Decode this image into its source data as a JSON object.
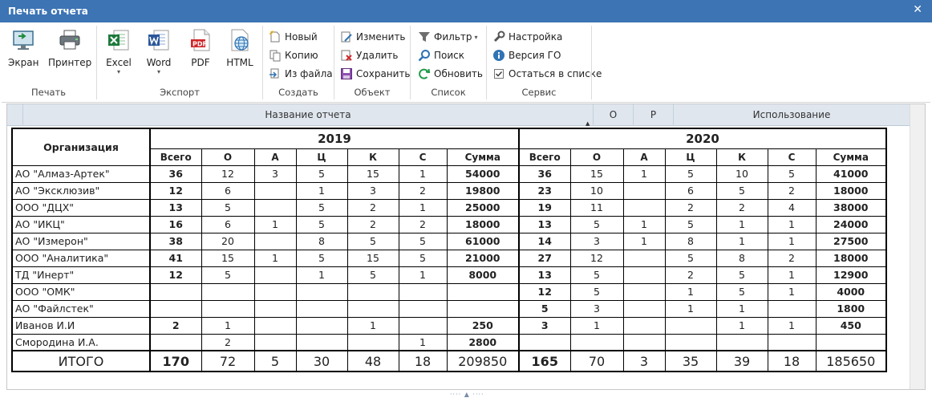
{
  "window": {
    "title": "Печать отчета",
    "close": "✕"
  },
  "ribbon": {
    "print": {
      "caption": "Печать",
      "screen": "Экран",
      "printer": "Принтер"
    },
    "export": {
      "caption": "Экспорт",
      "excel": "Excel",
      "word": "Word",
      "pdf": "PDF",
      "html": "HTML",
      "dropdown": "▾"
    },
    "create": {
      "caption": "Создать",
      "new": "Новый",
      "copy": "Копию",
      "from_file": "Из файла"
    },
    "object": {
      "caption": "Объект",
      "edit": "Изменить",
      "delete": "Удалить",
      "save": "Сохранить"
    },
    "list": {
      "caption": "Список",
      "filter": "Фильтр",
      "filter_dd": "▾",
      "search": "Поиск",
      "refresh": "Обновить"
    },
    "service": {
      "caption": "Сервис",
      "settings": "Настройка",
      "version": "Версия ГО",
      "stay_in_list": "Остаться в списке",
      "stay_checked": true
    }
  },
  "grid_header": {
    "name": "Название отчета",
    "o": "О",
    "r": "Р",
    "usage": "Использование",
    "sort": "▲"
  },
  "report": {
    "org_header": "Организация",
    "year1": "2019",
    "year2": "2020",
    "columns": [
      "Всего",
      "О",
      "А",
      "Ц",
      "К",
      "С",
      "Сумма"
    ],
    "rows": [
      {
        "org": "АО \"Алмаз-Артек\"",
        "y1": [
          "36",
          "12",
          "3",
          "5",
          "15",
          "1",
          "54000"
        ],
        "y2": [
          "36",
          "15",
          "1",
          "5",
          "10",
          "5",
          "41000"
        ]
      },
      {
        "org": "АО \"Эксклюзив\"",
        "y1": [
          "12",
          "6",
          "",
          "1",
          "3",
          "2",
          "19800"
        ],
        "y2": [
          "23",
          "10",
          "",
          "6",
          "5",
          "2",
          "18000"
        ]
      },
      {
        "org": "ООО \"ДЦХ\"",
        "y1": [
          "13",
          "5",
          "",
          "5",
          "2",
          "1",
          "25000"
        ],
        "y2": [
          "19",
          "11",
          "",
          "2",
          "2",
          "4",
          "38000"
        ]
      },
      {
        "org": "АО \"ИКЦ\"",
        "y1": [
          "16",
          "6",
          "1",
          "5",
          "2",
          "2",
          "18000"
        ],
        "y2": [
          "13",
          "5",
          "1",
          "5",
          "1",
          "1",
          "24000"
        ]
      },
      {
        "org": "АО \"Измерон\"",
        "y1": [
          "38",
          "20",
          "",
          "8",
          "5",
          "5",
          "61000"
        ],
        "y2": [
          "14",
          "3",
          "1",
          "8",
          "1",
          "1",
          "27500"
        ]
      },
      {
        "org": "ООО \"Аналитика\"",
        "y1": [
          "41",
          "15",
          "1",
          "5",
          "15",
          "5",
          "21000"
        ],
        "y2": [
          "27",
          "12",
          "",
          "5",
          "8",
          "2",
          "18000"
        ]
      },
      {
        "org": "ТД \"Инерт\"",
        "y1": [
          "12",
          "5",
          "",
          "1",
          "5",
          "1",
          "8000"
        ],
        "y2": [
          "13",
          "5",
          "",
          "2",
          "5",
          "1",
          "12900"
        ]
      },
      {
        "org": "ООО \"ОМК\"",
        "y1": [
          "",
          "",
          "",
          "",
          "",
          "",
          ""
        ],
        "y2": [
          "12",
          "5",
          "",
          "1",
          "5",
          "1",
          "4000"
        ]
      },
      {
        "org": "АО \"Файлстек\"",
        "y1": [
          "",
          "",
          "",
          "",
          "",
          "",
          ""
        ],
        "y2": [
          "5",
          "3",
          "",
          "1",
          "1",
          "",
          "1800"
        ]
      },
      {
        "org": "Иванов И.И",
        "y1": [
          "2",
          "1",
          "",
          "",
          "1",
          "",
          "250"
        ],
        "y2": [
          "3",
          "1",
          "",
          "",
          "1",
          "1",
          "450"
        ]
      },
      {
        "org": "Смородина И.А.",
        "y1": [
          "",
          "2",
          "",
          "",
          "",
          "1",
          "2800"
        ],
        "y2": [
          "",
          "",
          "",
          "",
          "",
          "",
          ""
        ]
      }
    ],
    "total": {
      "label": "ИТОГО",
      "y1": [
        "170",
        "72",
        "5",
        "30",
        "48",
        "18",
        "209850"
      ],
      "y2": [
        "165",
        "70",
        "3",
        "35",
        "39",
        "18",
        "185650"
      ]
    }
  },
  "bottom_handle": "···· ▲ ····"
}
